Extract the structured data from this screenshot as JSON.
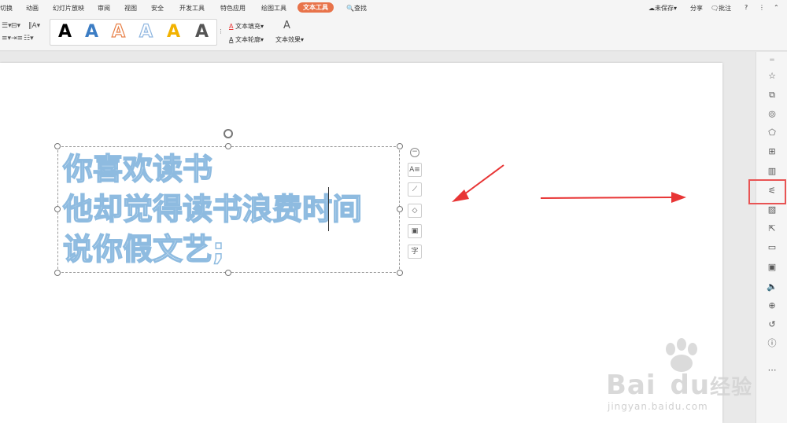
{
  "menu": {
    "items": [
      "切换",
      "动画",
      "幻灯片放映",
      "审阅",
      "视图",
      "安全",
      "开发工具",
      "特色应用",
      "绘图工具",
      "文本工具"
    ],
    "search": "查找",
    "right": [
      "未保存",
      "分享",
      "批注"
    ]
  },
  "ribbon": {
    "style_letter": "A",
    "text_fill": "文本填充",
    "text_outline": "文本轮廓",
    "text_effect": "文本效果",
    "style_colors": [
      "#000000",
      "#3c7dc4",
      "#e8824a",
      "#8fb6e0",
      "#f2b200",
      "#555555"
    ]
  },
  "slide": {
    "lines": [
      "你喜欢读书",
      "他却觉得读书浪费时间",
      "说你假文艺;"
    ],
    "float_tool_char": "字"
  },
  "colors": {
    "accent": "#e8734a",
    "outline_text": "#8ebbe0",
    "annotation": "#e83535"
  },
  "watermark": {
    "brand": "Bai",
    "brand_tail": "du",
    "brand_cn": "经验",
    "site": "jingyan.baidu.com"
  }
}
